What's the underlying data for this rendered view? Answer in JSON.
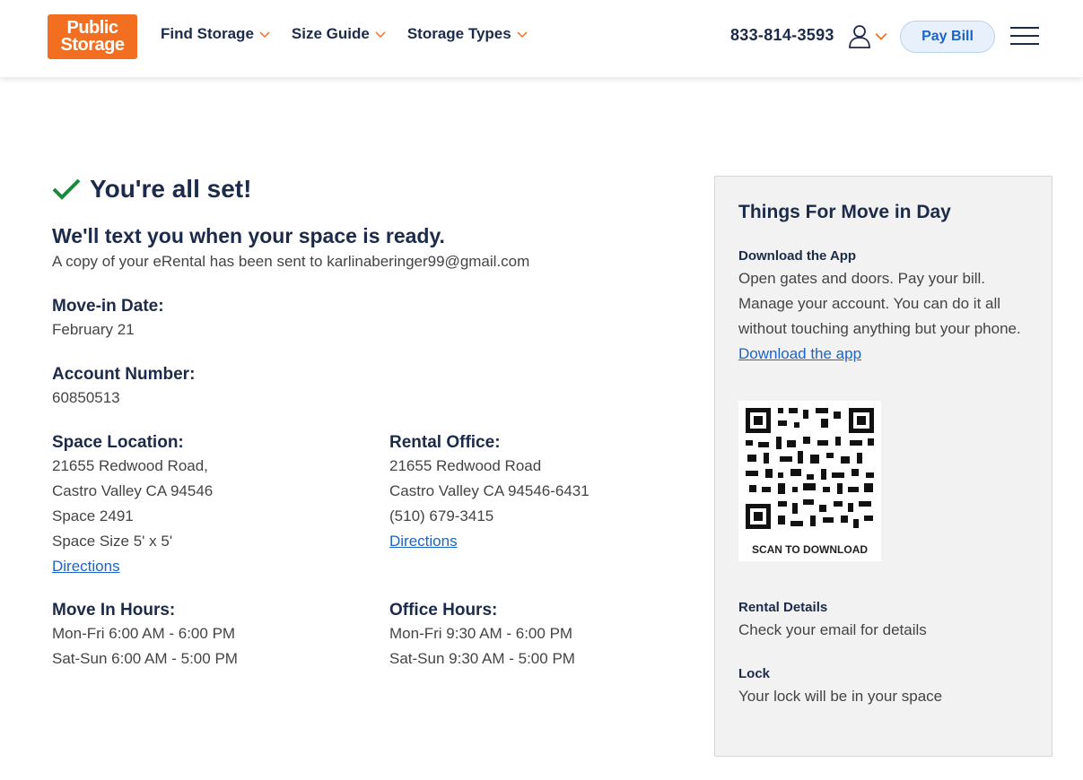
{
  "header": {
    "logo_line1": "Public",
    "logo_line2": "Storage",
    "nav": [
      "Find Storage",
      "Size Guide",
      "Storage Types"
    ],
    "phone": "833-814-3593",
    "pay_bill": "Pay Bill",
    "brand_color": "#f26f21"
  },
  "confirmation": {
    "title": "You're all set!",
    "subtitle": "We'll text you when your space is ready.",
    "email_note": "A copy of your eRental has been sent to karlinaberinger99@gmail.com",
    "move_in_label": "Move-in Date:",
    "move_in_value": "February 21",
    "account_label": "Account Number:",
    "account_value": "60850513"
  },
  "space": {
    "label": "Space Location:",
    "line1": "21655 Redwood Road,",
    "line2": "Castro Valley CA 94546",
    "line3": "Space 2491",
    "line4": "Space Size 5' x 5'",
    "directions": "Directions"
  },
  "office": {
    "label": "Rental Office:",
    "line1": "21655 Redwood Road",
    "line2": "Castro Valley CA 94546-6431",
    "phone": "(510) 679-3415",
    "directions": "Directions"
  },
  "move_hours": {
    "label": "Move In Hours:",
    "weekday": "Mon-Fri 6:00 AM - 6:00 PM",
    "weekend": "Sat-Sun 6:00 AM - 5:00 PM"
  },
  "office_hours": {
    "label": "Office Hours:",
    "weekday": "Mon-Fri 9:30 AM - 6:00 PM",
    "weekend": "Sat-Sun 9:30 AM - 5:00 PM"
  },
  "sidebar": {
    "title": "Things For Move in Day",
    "app_label": "Download the App",
    "app_text": "Open gates and doors. Pay your bill. Manage your account. You can do it all without touching anything but your phone.",
    "app_link": "Download the app",
    "qr_caption": "SCAN TO DOWNLOAD",
    "rental_label": "Rental Details",
    "rental_text": "Check your email for details",
    "lock_label": "Lock",
    "lock_text": "Your lock will be in your space"
  }
}
